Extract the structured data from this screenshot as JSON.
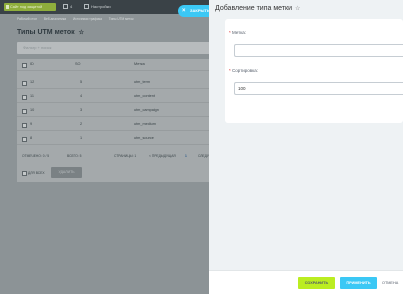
{
  "topbar": {
    "site_label": "Сайт под защитой",
    "counter": "4",
    "settings_label": "Настройки"
  },
  "breadcrumbs": [
    "Рабочий стол",
    "Веб-аналитика",
    "Источники трафика",
    "Типы UTM меток"
  ],
  "page_title": "Типы UTM меток",
  "filter_placeholder": "Фильтр + поиск",
  "grid": {
    "headers": {
      "id": "ID",
      "sort": "SO",
      "label": "Метка"
    },
    "rows": [
      {
        "id": "12",
        "sort": "5",
        "label": "utm_term"
      },
      {
        "id": "11",
        "sort": "4",
        "label": "utm_content"
      },
      {
        "id": "10",
        "sort": "3",
        "label": "utm_campaign"
      },
      {
        "id": "9",
        "sort": "2",
        "label": "utm_medium"
      },
      {
        "id": "8",
        "sort": "1",
        "label": "utm_source"
      }
    ]
  },
  "footer": {
    "selected": "ОТМЕЧЕНО: 0 / 5",
    "total": "ВСЕГО: 5",
    "pages": "СТРАНИЦЫ: 1",
    "prev": "< ПРЕДЫДУЩАЯ",
    "current": "1",
    "next": "СЛЕДУ"
  },
  "actions": {
    "for_all": "ДЛЯ ВСЕХ",
    "delete": "УДАЛИТЬ"
  },
  "close_tab": {
    "icon": "close-icon",
    "label": "ЗАКРЫТЬ"
  },
  "panel": {
    "title": "Добавление типа метки",
    "fields": {
      "label": {
        "caption": "Метка:",
        "required_mark": "*",
        "value": ""
      },
      "sort": {
        "caption": "Сортировка:",
        "required_mark": "*",
        "value": "100"
      }
    },
    "buttons": {
      "save": "СОХРАНИТЬ",
      "apply": "ПРИМЕНИТЬ",
      "cancel": "ОТМЕНА"
    }
  },
  "colors": {
    "accent_blue": "#3bc8f5",
    "save_green": "#bbed21"
  }
}
